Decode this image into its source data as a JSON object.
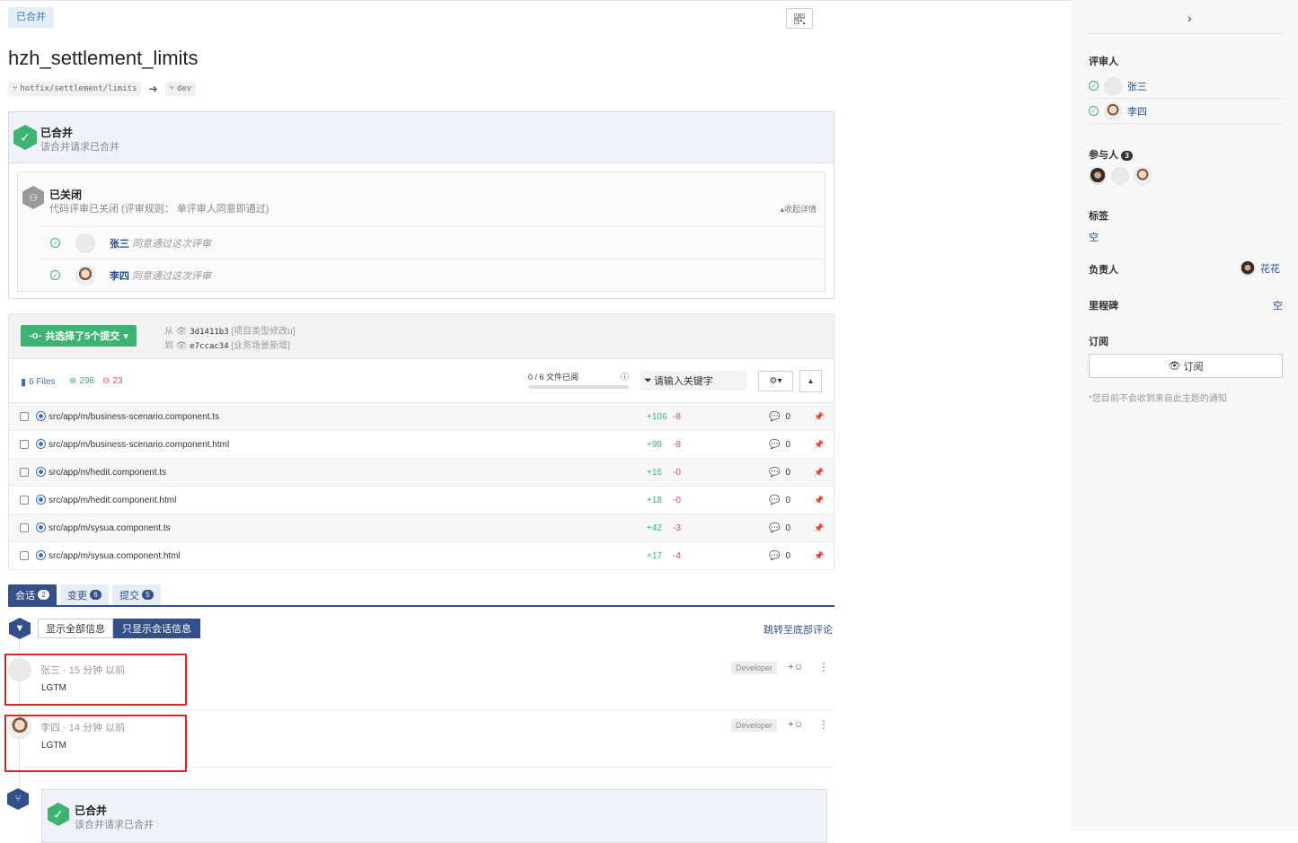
{
  "header": {
    "status_badge": "已合并",
    "title": "hzh_settlement_limits",
    "source_branch": "hotfix/settlement/limits",
    "target_branch": "dev"
  },
  "merge_status": {
    "title": "已合并",
    "subtitle": "该合并请求已合并"
  },
  "review": {
    "title": "已关闭",
    "subtitle": "代码评审已关闭 (评审规则： 单评审人同意即通过)",
    "collapse_label": "收起详情",
    "reviewers": [
      {
        "name": "张三",
        "note": "同意通过这次评审"
      },
      {
        "name": "李四",
        "note": "同意通过这次评审"
      }
    ]
  },
  "commits": {
    "button_label": "共选择了5个提交",
    "from_label": "从",
    "from_hash": "3d1411b3",
    "from_msg": "[项目类型修改u]",
    "to_label": "到",
    "to_hash": "e7ccac34",
    "to_msg": "[业务场景新增]"
  },
  "files": {
    "count_label": "6 Files",
    "additions": "298",
    "deletions": "23",
    "viewed_label": "0 / 6 文件已阅",
    "viewed_fraction": 0,
    "filter_placeholder": "请输入关键字",
    "rows": [
      {
        "path": "src/app/m/business-scenario.component.ts",
        "add": "+106",
        "del": "-8",
        "comments": "0"
      },
      {
        "path": "src/app/m/business-scenario.component.html",
        "add": "+99",
        "del": "-8",
        "comments": "0"
      },
      {
        "path": "src/app/m/hedit.component.ts",
        "add": "+16",
        "del": "-0",
        "comments": "0"
      },
      {
        "path": "src/app/m/hedit.component.html",
        "add": "+18",
        "del": "-0",
        "comments": "0"
      },
      {
        "path": "src/app/m/sysua.component.ts",
        "add": "+42",
        "del": "-3",
        "comments": "0"
      },
      {
        "path": "src/app/m/sysua.component.html",
        "add": "+17",
        "del": "-4",
        "comments": "0"
      }
    ]
  },
  "tabs": [
    {
      "label": "会话",
      "count": "2"
    },
    {
      "label": "变更",
      "count": "6"
    },
    {
      "label": "提交",
      "count": "5"
    }
  ],
  "conversation": {
    "show_all": "显示全部信息",
    "show_conversation": "只显示会话信息",
    "jump_bottom": "跳转至底部评论",
    "comments": [
      {
        "meta": "张三 · 15 分钟 以前",
        "body": "LGTM",
        "role": "Developer",
        "emoji": "+☺"
      },
      {
        "meta": "李四 · 14 分钟 以前",
        "body": "LGTM",
        "role": "Developer",
        "emoji": "+☺"
      }
    ],
    "merged_event": {
      "title": "已合并",
      "subtitle": "该合并请求已合并"
    }
  },
  "sidebar": {
    "reviewers_title": "评审人",
    "reviewers": [
      "张三",
      "李四"
    ],
    "participants_title": "参与人",
    "participants_count": "3",
    "labels_title": "标签",
    "labels_value": "空",
    "assignee_title": "负责人",
    "assignee_name": "花花",
    "milestone_title": "里程碑",
    "milestone_value": "空",
    "subscribe_title": "订阅",
    "subscribe_button": "订阅",
    "subscribe_note": "*您目前不会收到来自此主题的通知"
  },
  "colors": {
    "accent": "#34508a",
    "success": "#3cb371",
    "danger": "#d9534f"
  }
}
